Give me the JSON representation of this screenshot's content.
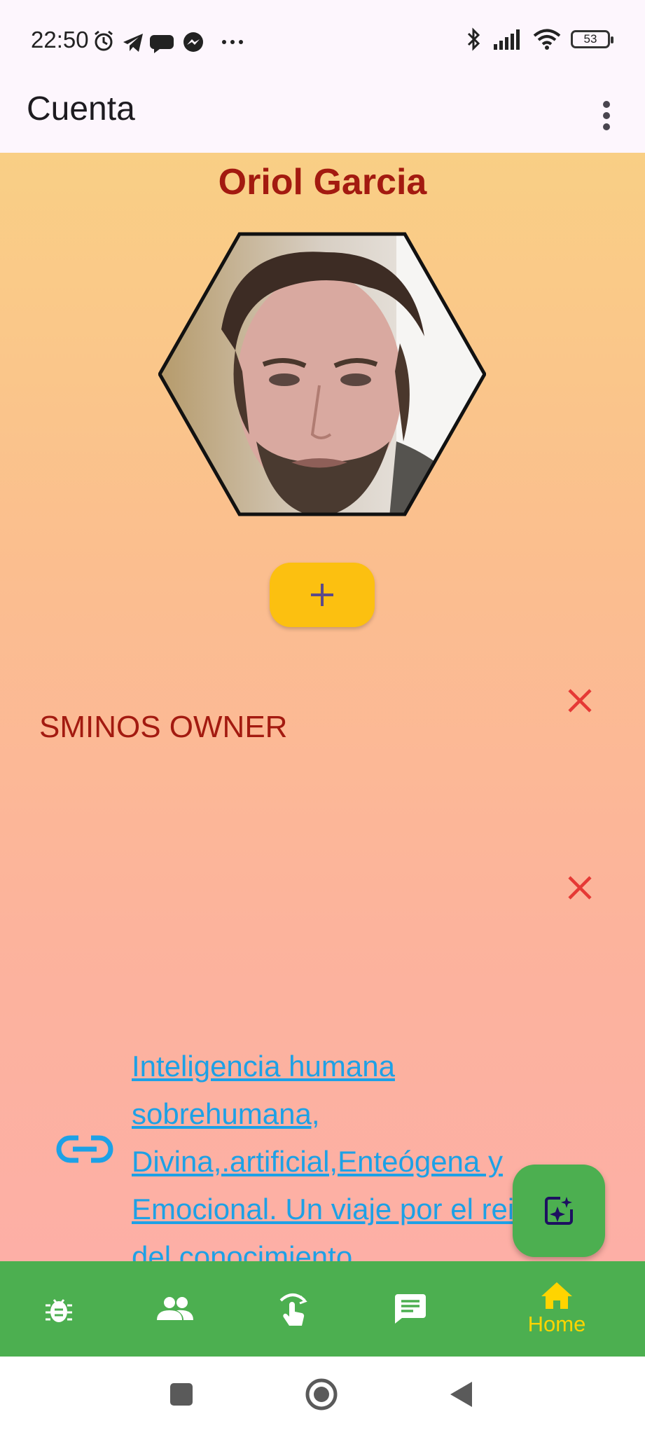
{
  "status_bar": {
    "time": "22:50",
    "battery": "53",
    "icons": [
      "alarm-icon",
      "telegram-icon",
      "chat-bubble-icon",
      "messenger-icon",
      "more-dots-icon",
      "bluetooth-icon",
      "signal-icon",
      "wifi-icon",
      "battery-icon"
    ]
  },
  "app_bar": {
    "title": "Cuenta",
    "menu_icon": "more-vert-icon"
  },
  "profile": {
    "name": "Oriol Garcia",
    "role": "SMINOS OWNER",
    "link_text": "Inteligencia humana sobrehumana, Divina,.artificial,Enteógena y Emocional. Un viaje por el reino del conocimiento"
  },
  "colors": {
    "accent_red": "#a31a10",
    "fab_green": "#4caf50",
    "add_yellow": "#fcc010",
    "link_blue": "#1da1e6",
    "home_active": "#ffd400"
  },
  "fabs": [
    "ai-image-icon",
    "gallery-icon",
    "camera-icon"
  ],
  "bottom_nav": {
    "items": [
      {
        "icon": "bug-icon",
        "label": ""
      },
      {
        "icon": "people-icon",
        "label": ""
      },
      {
        "icon": "touch-icon",
        "label": ""
      },
      {
        "icon": "message-icon",
        "label": ""
      },
      {
        "icon": "home-icon",
        "label": "Home"
      }
    ],
    "active_index": 4
  }
}
